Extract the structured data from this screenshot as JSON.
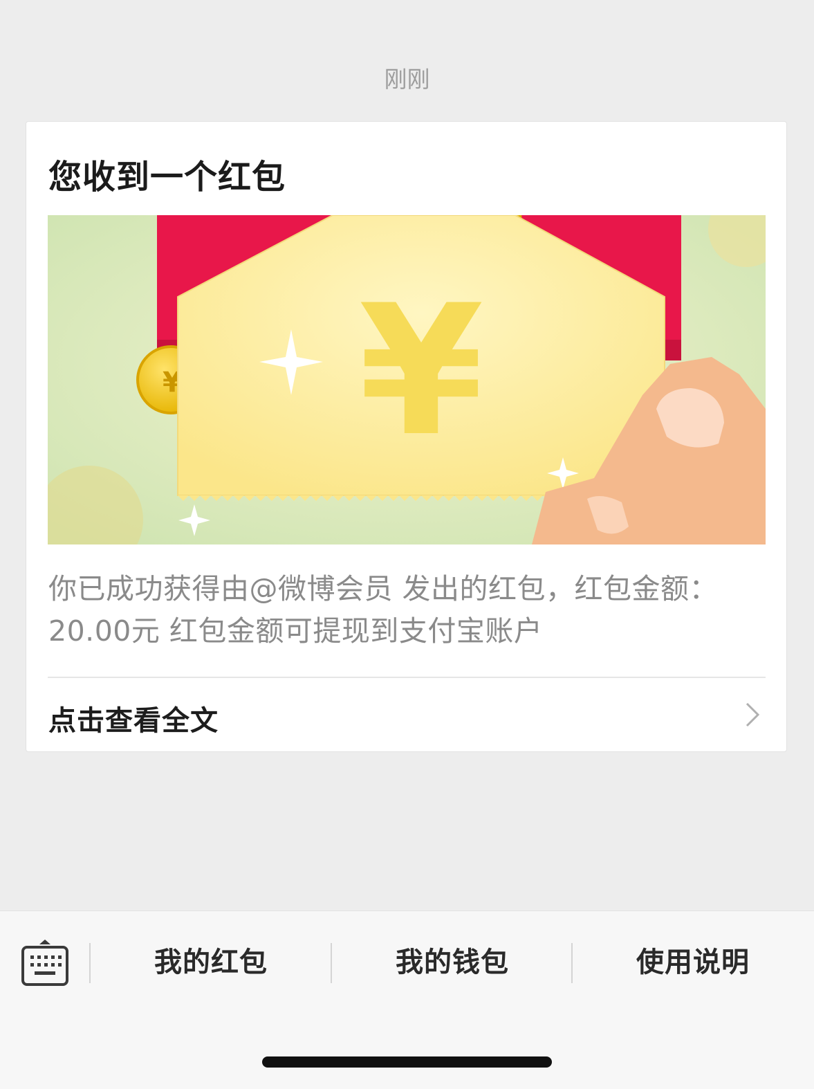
{
  "header": {
    "timestamp": "刚刚"
  },
  "card": {
    "title": "您收到一个红包",
    "banner": {
      "symbol": "¥",
      "icon": "red-envelope-illustration"
    },
    "message": "你已成功获得由@微博会员 发出的红包，红包金额：20.00元 红包金额可提现到支付宝账户",
    "read_more": "点击查看全文"
  },
  "bottom_bar": {
    "keyboard_icon": "keyboard-icon",
    "items": [
      {
        "label": "我的红包"
      },
      {
        "label": "我的钱包"
      },
      {
        "label": "使用说明"
      }
    ]
  },
  "colors": {
    "background": "#ededed",
    "card": "#ffffff",
    "envelope_red": "#e8174a",
    "coin_gold": "#f7cf2b",
    "banner_green": "#dfeac8"
  }
}
